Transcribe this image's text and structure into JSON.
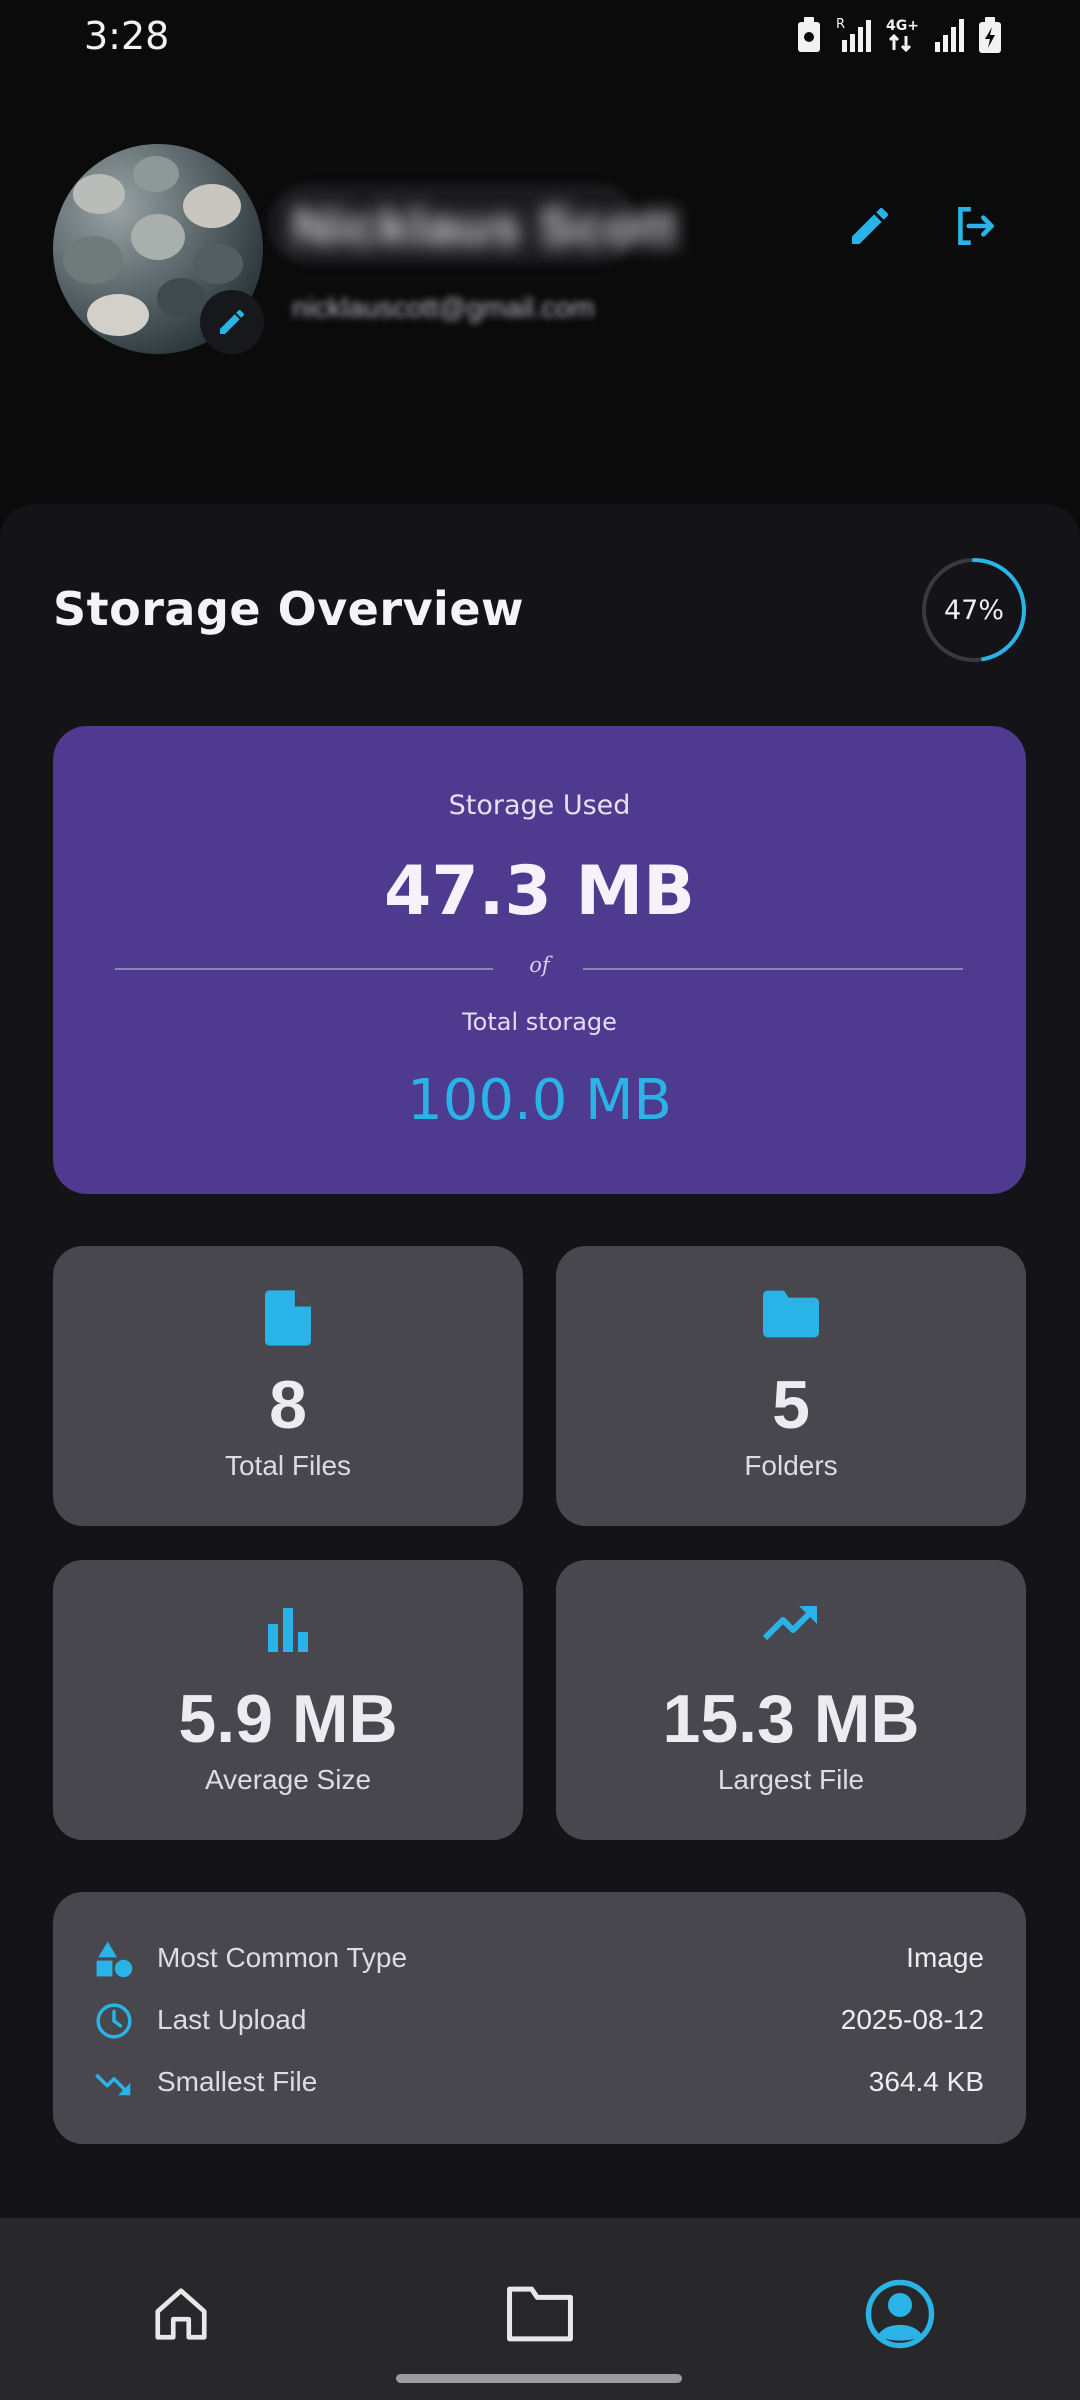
{
  "status_bar": {
    "time": "3:28",
    "icons": [
      "battery-saver-icon",
      "signal-r-icon",
      "network-4g-icon",
      "signal-icon",
      "battery-charging-icon"
    ]
  },
  "profile": {
    "name": "Nicklaus Scott",
    "email": "nicklauscott@gmail.com",
    "icons": [
      "edit-avatar-icon",
      "edit-profile-icon",
      "logout-icon"
    ]
  },
  "overview": {
    "title": "Storage Overview",
    "percent_label": "47%",
    "percent_value": 0.47
  },
  "usage_card": {
    "used_label": "Storage Used",
    "used_value": "47.3 MB",
    "of_label": "of",
    "total_label": "Total storage",
    "total_value": "100.0 MB"
  },
  "stats": [
    {
      "icon": "file-icon",
      "value": "8",
      "label": "Total Files"
    },
    {
      "icon": "folder-icon",
      "value": "5",
      "label": "Folders"
    },
    {
      "icon": "bar-chart-icon",
      "value": "5.9 MB",
      "label": "Average Size"
    },
    {
      "icon": "trending-up-icon",
      "value": "15.3 MB",
      "label": "Largest File"
    }
  ],
  "details": [
    {
      "icon": "shapes-icon",
      "label": "Most Common Type",
      "value": "Image"
    },
    {
      "icon": "clock-icon",
      "label": "Last Upload",
      "value": "2025-08-12"
    },
    {
      "icon": "trending-down-icon",
      "label": "Smallest File",
      "value": "364.4 KB"
    }
  ],
  "bottom_nav": {
    "items": [
      "home-icon",
      "folder-icon",
      "account-icon"
    ],
    "active": "account-icon"
  },
  "colors": {
    "accent": "#29B3E6",
    "usage_card": "#4E3A8E",
    "card": "#48474E",
    "sheet": "#141317",
    "background": "#0B0B0C"
  }
}
